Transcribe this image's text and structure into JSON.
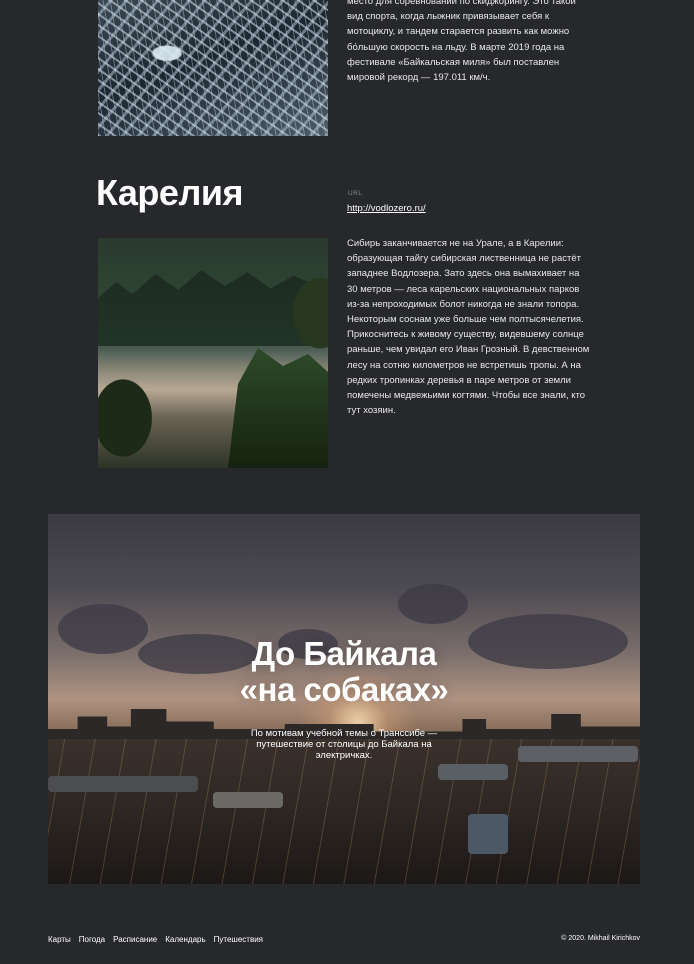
{
  "baikal_block": {
    "text": "место для соревнований по скиджорингу. Это такой вид спорта, когда лыжник привязывает себя к мотоциклу, и тандем старается развить как можно бо́льшую скорость на льду. В марте 2019 года на фестивале «Байкальская миля» был поставлен мировой рекорд — 197.011 км/ч."
  },
  "karelia": {
    "title": "Карелия",
    "url_label": "URL",
    "url": "http://vodlozero.ru/",
    "text": "Сибирь заканчивается не на Урале, а в Карелии: образующая тайгу сибирская лиственница не растёт западнее Водлозера. Зато здесь она вымахивает на 30 метров — леса карельских национальных парков из-за непроходимых болот никогда не знали топора. Некоторым соснам уже больше чем полтысячелетия. Прикоснитесь к живому существу, видевшему солнце раньше, чем увидал его Иван Грозный. В девственном лесу на сотню километров не встретишь тропы. А на редких тропинках деревья в паре метров от земли помечены медвежьими когтями. Чтобы все знали, кто тут хозяин."
  },
  "hero": {
    "title_line1": "До Байкала",
    "title_line2": "«на собаках»",
    "subtitle": "По мотивам учебной темы о Транссибе — путешествие от столицы до Байкала на электричках."
  },
  "footer": {
    "nav": [
      "Карты",
      "Погода",
      "Расписание",
      "Календарь",
      "Путешествия"
    ],
    "copyright": "© 2020. Mikhail Kirichkov"
  }
}
